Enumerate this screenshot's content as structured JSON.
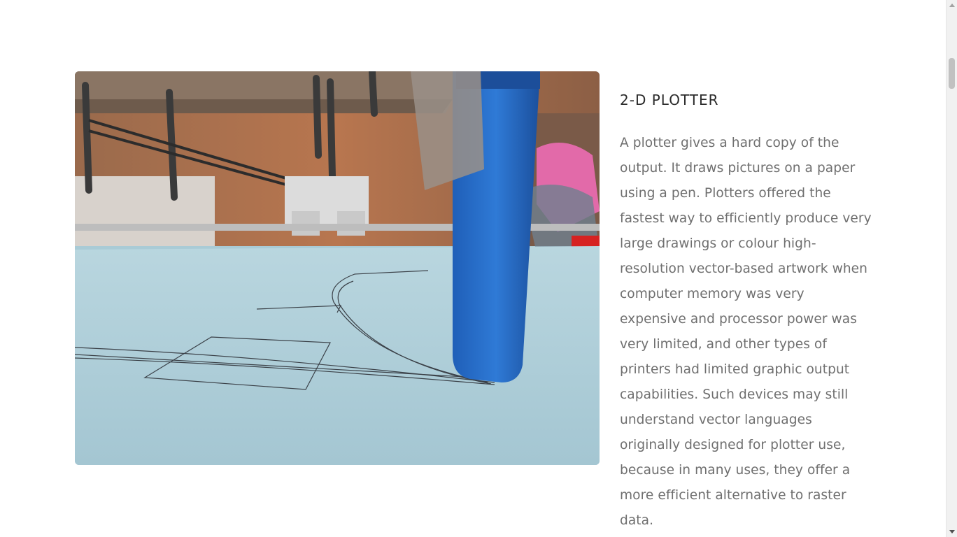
{
  "section": {
    "title": "2-D PLOTTER",
    "paragraph": "A plotter gives a hard copy of the output. It draws pictures on a paper using a pen. Plotters offered the fastest way to efficiently produce very large drawings or colour high-resolution vector-based artwork when computer memory was very expensive and processor power was very limited, and other types of printers had limited graphic output capabilities. Such devices may still understand vector languages originally designed for plotter use, because in many uses, they offer a more efficient alternative to raster data."
  },
  "image": {
    "subject": "2-D plotter drawing lines on paper with a blue pen holder"
  },
  "colors": {
    "title": "#2b2b2b",
    "body": "#6f6f6f",
    "paper": "#a9cbd6",
    "pen_holder": "#2a6ec8"
  }
}
